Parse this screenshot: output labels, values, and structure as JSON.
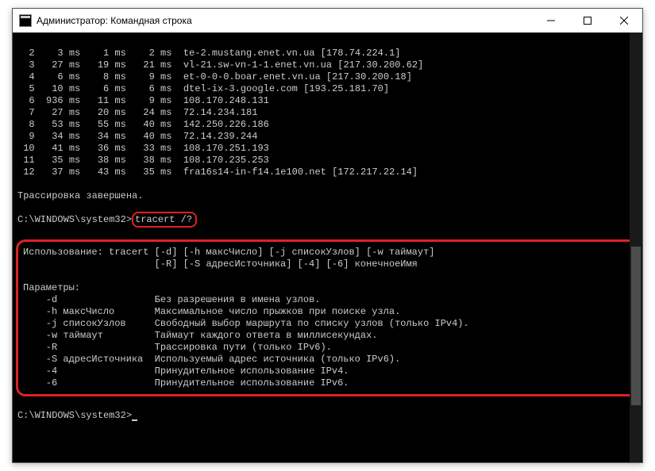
{
  "titlebar": {
    "title": "Администратор: Командная строка"
  },
  "hops": [
    {
      "n": "  2",
      "t1": "    3 ms",
      "t2": "    1 ms",
      "t3": "    2 ms",
      "host": "te-2.mustang.enet.vn.ua [178.74.224.1]"
    },
    {
      "n": "  3",
      "t1": "   27 ms",
      "t2": "   19 ms",
      "t3": "   21 ms",
      "host": "vl-21.sw-vn-1-1.enet.vn.ua [217.30.200.62]"
    },
    {
      "n": "  4",
      "t1": "    6 ms",
      "t2": "    8 ms",
      "t3": "    9 ms",
      "host": "et-0-0-0.boar.enet.vn.ua [217.30.200.18]"
    },
    {
      "n": "  5",
      "t1": "   10 ms",
      "t2": "    6 ms",
      "t3": "    6 ms",
      "host": "dtel-ix-3.google.com [193.25.181.70]"
    },
    {
      "n": "  6",
      "t1": "  936 ms",
      "t2": "   11 ms",
      "t3": "    9 ms",
      "host": "108.170.248.131"
    },
    {
      "n": "  7",
      "t1": "   27 ms",
      "t2": "   20 ms",
      "t3": "   24 ms",
      "host": "72.14.234.181"
    },
    {
      "n": "  8",
      "t1": "   53 ms",
      "t2": "   55 ms",
      "t3": "   40 ms",
      "host": "142.250.226.186"
    },
    {
      "n": "  9",
      "t1": "   34 ms",
      "t2": "   34 ms",
      "t3": "   40 ms",
      "host": "72.14.239.244"
    },
    {
      "n": " 10",
      "t1": "   41 ms",
      "t2": "   36 ms",
      "t3": "   33 ms",
      "host": "108.170.251.193"
    },
    {
      "n": " 11",
      "t1": "   35 ms",
      "t2": "   38 ms",
      "t3": "   38 ms",
      "host": "108.170.235.253"
    },
    {
      "n": " 12",
      "t1": "   37 ms",
      "t2": "   43 ms",
      "t3": "   35 ms",
      "host": "fra16s14-in-f14.1e100.net [172.217.22.14]"
    }
  ],
  "trace_complete": "Трассировка завершена.",
  "prompt1": "C:\\WINDOWS\\system32>",
  "cmd": "tracert /?",
  "usage": {
    "line1": "Использование: tracert [-d] [-h максЧисло] [-j списокУзлов] [-w таймаут]",
    "line2": "                       [-R] [-S адресИсточника] [-4] [-6] конечноеИмя"
  },
  "params_header": "Параметры:",
  "params": [
    {
      "flag": "    -d                 ",
      "desc": "Без разрешения в имена узлов."
    },
    {
      "flag": "    -h максЧисло       ",
      "desc": "Максимальное число прыжков при поиске узла."
    },
    {
      "flag": "    -j списокУзлов     ",
      "desc": "Свободный выбор маршрута по списку узлов (только IPv4)."
    },
    {
      "flag": "    -w таймаут         ",
      "desc": "Таймаут каждого ответа в миллисекундах."
    },
    {
      "flag": "    -R                 ",
      "desc": "Трассировка пути (только IPv6)."
    },
    {
      "flag": "    -S адресИсточника  ",
      "desc": "Используемый адрес источника (только IPv6)."
    },
    {
      "flag": "    -4                 ",
      "desc": "Принудительное использование IPv4."
    },
    {
      "flag": "    -6                 ",
      "desc": "Принудительное использование IPv6."
    }
  ],
  "prompt2": "C:\\WINDOWS\\system32>"
}
